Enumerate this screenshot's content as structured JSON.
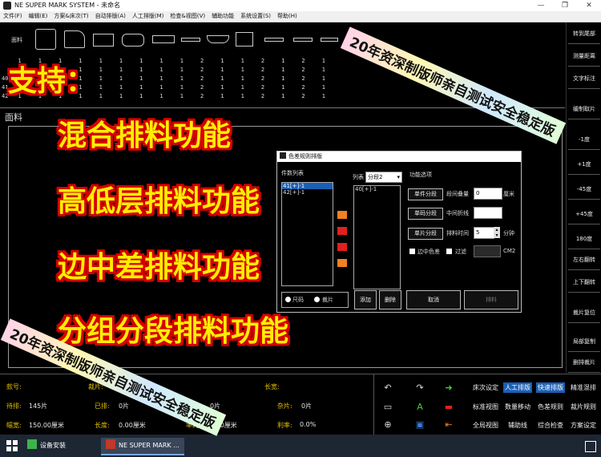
{
  "window": {
    "title": "NE SUPER MARK SYSTEM - 未命名"
  },
  "menu": [
    "文件(F)",
    "编辑(E)",
    "方案&床次(T)",
    "自动排版(A)",
    "人工排版(M)",
    "检查&视图(V)",
    "辅助功能",
    "系统设置(S)",
    "帮助(H)"
  ],
  "pieces_panel": {
    "label": "面料",
    "rows": [
      "  1     1     1     1     1     1     1     1     1     2     1     1     2     1     2     1",
      "  1     1     1     1     1     1     1     1     1     2     1     1     2     1     2     1",
      "  1     1     1     1     1     1     1     1     1     2     1     1     2     1     2     1",
      "  1     1     1     1     1     1     1     1     1     2     1     1     2     1     2     1",
      "  1     1     1     1     1     1     1     1     1     2     1     1     2     1     2     1"
    ],
    "row_labels": [
      "40",
      "41",
      "42"
    ]
  },
  "main_area": {
    "label": "面料"
  },
  "right_toolbar": [
    "转到尾部",
    "测量距离",
    "文字标注",
    "缓制取片",
    "-1度",
    "+1度",
    "-45度",
    "+45度",
    "180度",
    "左右翻转",
    "上下翻转",
    "裁片复位",
    "局部复制",
    "删排裁片"
  ],
  "dialog": {
    "title": "色差规则排版",
    "piece_list_label": "件数列表",
    "piece_list_items": [
      "41[+]-1",
      "42[+]-1"
    ],
    "column_label": "列表",
    "group_select": "分段2",
    "column_items": [
      "40[+]-1"
    ],
    "options_label": "功能选项",
    "btn_single_group": "单件分段",
    "btn_single_code": "单码分段",
    "btn_single_piece": "单片分段",
    "lbl_segment_overlap": "段间叠量",
    "val_segment_overlap": "0",
    "unit_cm": "厘米",
    "lbl_mid_fold": "中间折线",
    "val_mid_fold": "",
    "lbl_time": "排料时间",
    "val_time": "5",
    "unit_minute": "分钟",
    "chk_edge_diff": "边中色差",
    "chk_filter": "过滤",
    "unit_cm2": "CM2",
    "radio_size": "尺码",
    "radio_piece": "裁片",
    "btn_add": "添加",
    "btn_delete": "删除",
    "btn_cancel": "取消",
    "btn_ok": "排料"
  },
  "bottom_panel": {
    "labels": {
      "style": "款号:",
      "cut": "裁片:",
      "pending": "待排:",
      "arranged": "已排:",
      "width": "幅宽:",
      "length": "长度:",
      "loss": "率耗:",
      "misc": "杂片:",
      "usage": "利率:",
      "length2": "长宽:"
    },
    "values": {
      "pending": "145片",
      "arranged": "0片",
      "misc": "0片",
      "width": "150.00厘米",
      "length": "0.00厘米",
      "loss": "0.00厘米",
      "usage": "0.0%"
    },
    "tools": [
      "床次设定",
      "人工排版",
      "快速排版",
      "精准混排",
      "标准视图",
      "数量移动",
      "色差规则",
      "裁片规则",
      "全局视图",
      "辅助线",
      "综合检查",
      "方案设定"
    ],
    "highlighted_tools": [
      "人工排版",
      "快速排版"
    ]
  },
  "taskbar": {
    "items": [
      "设备安装",
      "NE SUPER MARK ..."
    ]
  },
  "overlay": {
    "support": "支持：",
    "features": [
      "混合排料功能",
      "高低层排料功能",
      "边中差排料功能",
      "分组分段排料功能"
    ],
    "banner_top": "20年资深制版师亲自测试安全稳定版",
    "banner_bottom": "20年资深制版师亲自测试安全稳定版"
  },
  "colors": {
    "accent_yellow": "#ffee00",
    "outline_red": "#d40000",
    "label_yellow": "#e6c200",
    "highlight_blue": "#1a5fb4"
  }
}
